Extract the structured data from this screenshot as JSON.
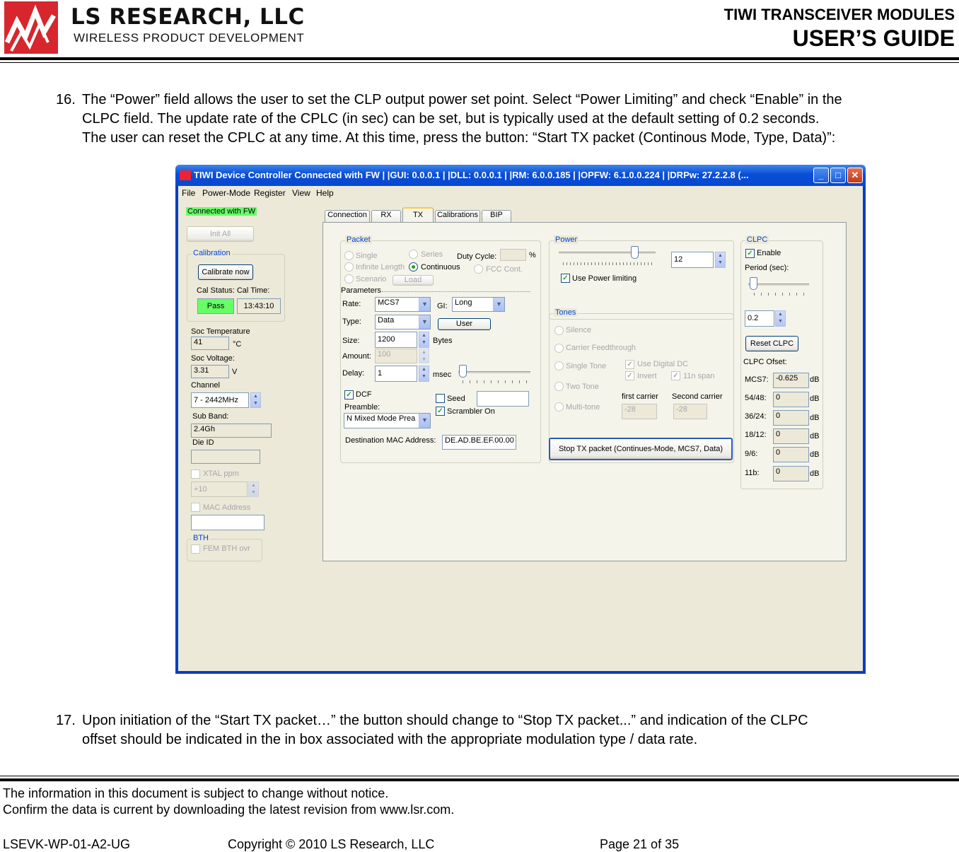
{
  "header": {
    "company": "LS RESEARCH, LLC",
    "tagline": "WIRELESS PRODUCT DEVELOPMENT",
    "doc_title": "TIWI TRANSCEIVER MODULES",
    "doc_subtitle": "USER’S GUIDE"
  },
  "body": {
    "item16_num": "16.",
    "item16_lines": [
      "The “Power” field allows the user to set the CLP output power set point. Select “Power Limiting” and check “Enable” in the",
      "CLPC field.  The update rate of the CPLC (in sec) can be set, but is typically used at the default setting of 0.2 seconds.",
      "The user can reset the CPLC at any time. At this time, press the button: “Start TX packet (Continous Mode, Type, Data)”:"
    ],
    "item17_num": "17.",
    "item17_lines": [
      "Upon initiation of the “Start TX packet…” the button should change to “Stop TX packet...” and indication of the CLPC",
      "offset should be indicated in the in box associated with the appropriate modulation type / data rate."
    ]
  },
  "app": {
    "title": "TIWI Device Controller Connected with FW  | |GUI: 0.0.0.1  | |DLL: 0.0.0.1  | |RM: 6.0.0.185  | |OPFW: 6.1.0.0.224  | |DRPw: 27.2.2.8 (...",
    "menu": [
      "File",
      "Power-Mode",
      "Register",
      "View",
      "Help"
    ],
    "left": {
      "status": "Connected with FW",
      "init_all": "Init All",
      "calibration_group": "Calibration",
      "calibrate_now": "Calibrate now",
      "cal_status_label": "Cal Status: Cal Time:",
      "cal_status": "Pass",
      "cal_time": "13:43:10",
      "soc_temp_label": "Soc Temperature",
      "soc_temp": "41",
      "soc_temp_unit": "°C",
      "soc_voltage_label": "Soc Voltage:",
      "soc_voltage": "3.31",
      "soc_voltage_unit": "V",
      "channel_label": "Channel",
      "channel": "7 - 2442MHz",
      "subband_label": "Sub Band:",
      "subband": "2.4Gh",
      "die_id_label": "Die ID",
      "xtal_label": "XTAL ppm",
      "xtal": "+10",
      "mac_label": "MAC Address",
      "bth_group": "BTH",
      "fem_bth": "FEM BTH ovr"
    },
    "tabs": [
      "Connection",
      "RX",
      "TX",
      "Calibrations",
      "BIP"
    ],
    "packet": {
      "group": "Packet",
      "single": "Single",
      "series": "Series",
      "duty_cycle": "Duty Cycle:",
      "duty_unit": "%",
      "infinite": "Infinite Length",
      "continuous": "Continuous",
      "fcc": "FCC Cont.",
      "scenario": "Scenario",
      "load": "Load",
      "parameters": "Parameters",
      "rate_label": "Rate:",
      "rate": "MCS7",
      "gi_label": "GI:",
      "gi": "Long",
      "type_label": "Type:",
      "type": "Data",
      "user": "User",
      "size_label": "Size:",
      "size": "1200",
      "bytes": "Bytes",
      "amount_label": "Amount:",
      "amount": "100",
      "delay_label": "Delay:",
      "delay": "1",
      "msec": "msec",
      "dcf": "DCF",
      "seed": "Seed",
      "preamble_label": "Preamble:",
      "preamble": "N Mixed Mode Prea",
      "scrambler": "Scrambler On",
      "dest_mac_label": "Destination MAC Address:",
      "dest_mac": "DE.AD.BE.EF.00.00"
    },
    "power": {
      "group": "Power",
      "value": "12",
      "use_limiting": "Use Power limiting"
    },
    "tones": {
      "group": "Tones",
      "silence": "Silence",
      "carrier": "Carrier Feedthrough",
      "single_tone": "Single Tone",
      "use_digital_dc": "Use Digital DC",
      "two_tone": "Two Tone",
      "invert": "Invert",
      "span": "11n span",
      "multi_tone": "Multi-tone",
      "first_carrier_label": "first carrier",
      "first_carrier": "-28",
      "second_carrier_label": "Second carrier",
      "second_carrier": "-28",
      "stop_button": "Stop TX packet (Continues-Mode, MCS7, Data)"
    },
    "clpc": {
      "group": "CLPC",
      "enable": "Enable",
      "period_label": "Period (sec):",
      "period": "0.2",
      "reset": "Reset CLPC",
      "offset_label": "CLPC Ofset:",
      "rows": [
        {
          "label": "MCS7:",
          "value": "-0.625",
          "unit": "dB"
        },
        {
          "label": "54/48:",
          "value": "0",
          "unit": "dB"
        },
        {
          "label": "36/24:",
          "value": "0",
          "unit": "dB"
        },
        {
          "label": "18/12:",
          "value": "0",
          "unit": "dB"
        },
        {
          "label": "9/6:",
          "value": "0",
          "unit": "dB"
        },
        {
          "label": "11b:",
          "value": "0",
          "unit": "dB"
        }
      ]
    }
  },
  "footer": {
    "notice1": "The information in this document is subject to change without notice.",
    "notice2": "Confirm the data is current by downloading the latest revision from www.lsr.com.",
    "doc_id": "LSEVK-WP-01-A2-UG",
    "copyright": "Copyright © 2010 LS Research, LLC",
    "page": "Page 21 of 35"
  },
  "colors": {
    "logo_red": "#d7262d",
    "titlebar_blue": "#0a4ed8",
    "pass_green": "#66ff66",
    "check_green": "#21a121"
  }
}
